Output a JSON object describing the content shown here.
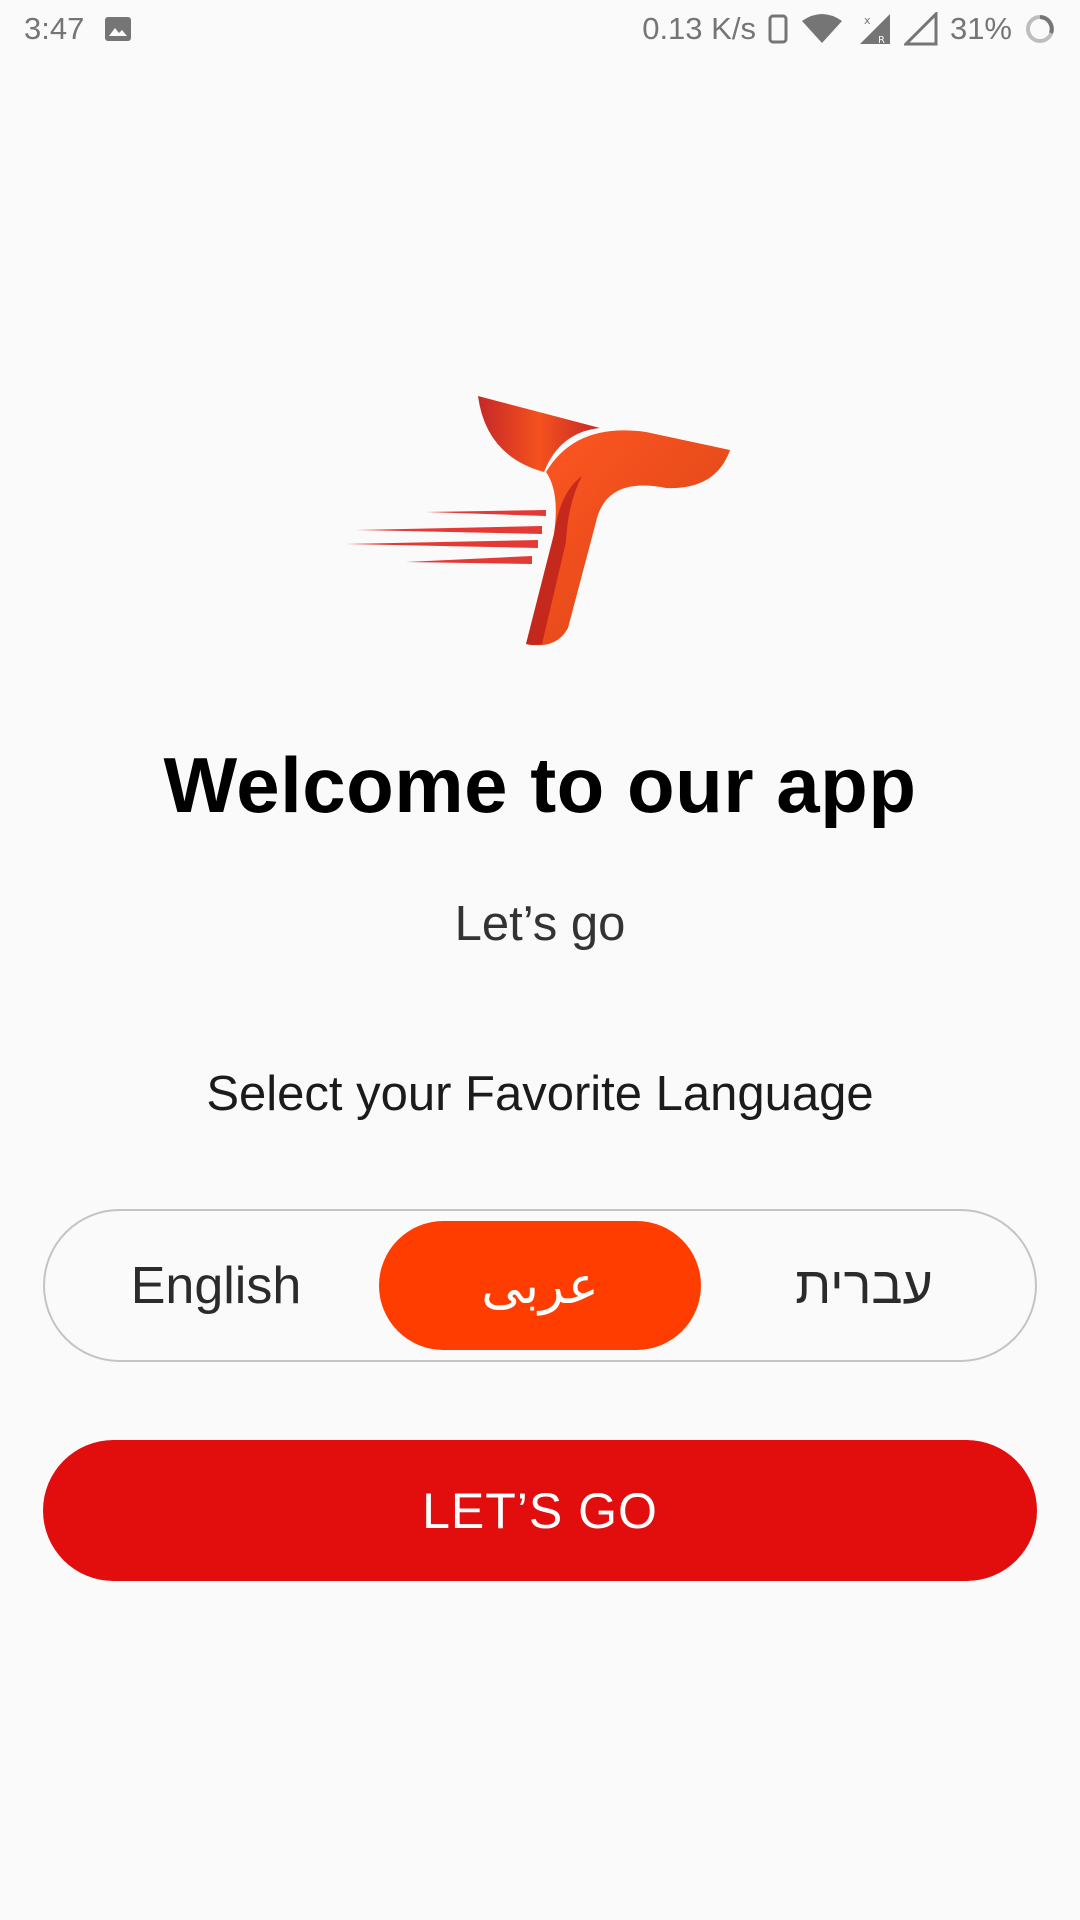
{
  "status_bar": {
    "time": "3:47",
    "network_speed": "0.13 K/s",
    "battery_percent": "31%",
    "icons": [
      "image-notification-icon",
      "phone-icon",
      "wifi-icon",
      "signal-icon",
      "signal-empty-icon",
      "battery-ring-icon"
    ]
  },
  "welcome": {
    "title": "Welcome to our app",
    "subtitle": "Let’s go"
  },
  "language": {
    "prompt": "Select your Favorite Language",
    "options": [
      {
        "label": "English",
        "selected": false
      },
      {
        "label": "عربى",
        "selected": true
      },
      {
        "label": "עברית",
        "selected": false
      }
    ]
  },
  "actions": {
    "go_label": "LET’S GO"
  },
  "colors": {
    "background": "#fafafa",
    "accent_selected": "#ff3d00",
    "primary_button": "#e20e0e",
    "logo_orange": "#f4511e",
    "logo_red": "#c62828"
  }
}
